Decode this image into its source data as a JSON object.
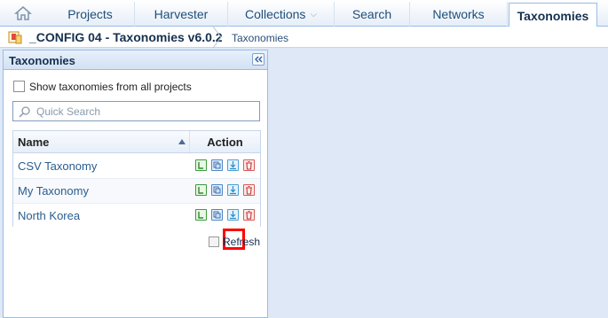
{
  "nav": {
    "tabs": [
      {
        "label": "Projects"
      },
      {
        "label": "Harvester"
      },
      {
        "label": "Collections",
        "has_dropdown": true
      },
      {
        "label": "Search"
      },
      {
        "label": "Networks"
      },
      {
        "label": "Taxonomies",
        "active": true
      }
    ]
  },
  "breadcrumb": {
    "project": "_CONFIG 04 - Taxonomies v6.0.2",
    "current": "Taxonomies"
  },
  "panel": {
    "title": "Taxonomies",
    "show_all_label": "Show taxonomies from all projects",
    "show_all_checked": false,
    "search_placeholder": "Quick Search",
    "columns": {
      "name": "Name",
      "action": "Action"
    },
    "rows": [
      {
        "name": "CSV Taxonomy"
      },
      {
        "name": "My Taxonomy"
      },
      {
        "name": "North Korea"
      }
    ],
    "refresh_label": "Refresh"
  },
  "colors": {
    "accent": "#99bbe8",
    "highlight": "#ff0000",
    "background": "#dfe8f6"
  }
}
